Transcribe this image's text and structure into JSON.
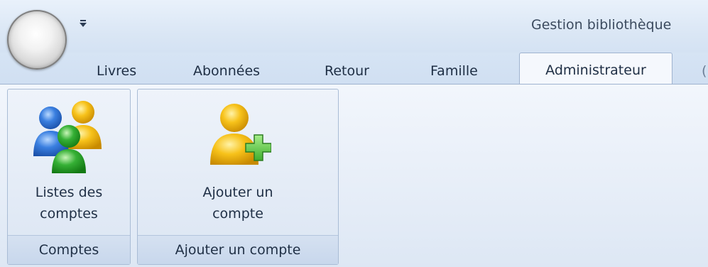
{
  "window": {
    "title": "Gestion bibliothèque"
  },
  "tabs": [
    {
      "label": "Livres"
    },
    {
      "label": "Abonnées"
    },
    {
      "label": "Retour"
    },
    {
      "label": "Famille"
    },
    {
      "label": "Administrateur",
      "active": true
    },
    {
      "label": "(",
      "partial": true
    }
  ],
  "ribbon": {
    "groups": [
      {
        "label": "Comptes",
        "button": {
          "line1": "Listes des",
          "line2": "comptes",
          "icon": "users-group-icon"
        }
      },
      {
        "label": "Ajouter un compte",
        "button": {
          "line1": "Ajouter un",
          "line2": "compte",
          "icon": "add-user-icon"
        }
      }
    ]
  },
  "colors": {
    "user_blue": "#2f6fd0",
    "user_yellow": "#f5b90c",
    "user_green": "#2ea52e",
    "plus_green": "#5fcf4a"
  }
}
